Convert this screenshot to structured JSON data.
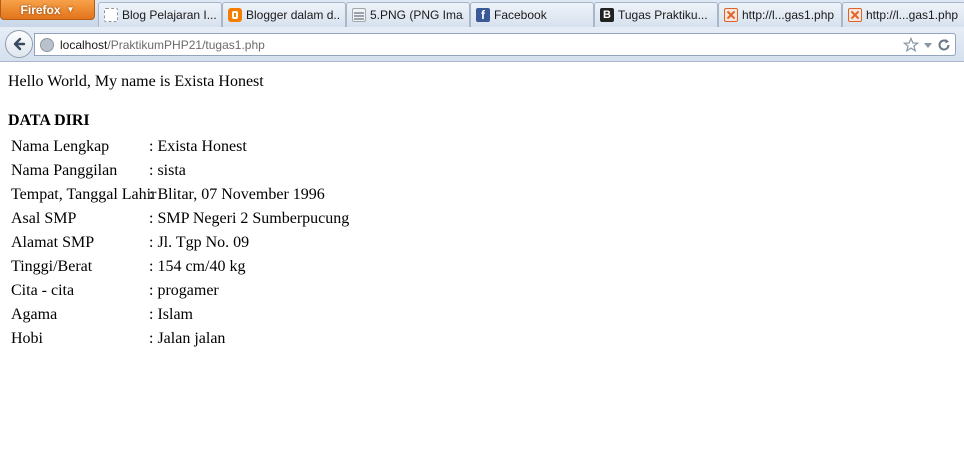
{
  "browser": {
    "menu_label": "Firefox",
    "tabs": [
      {
        "label": "Blog Pelajaran I...",
        "icon": "blank-page-icon"
      },
      {
        "label": "Blogger dalam d...",
        "icon": "blogger-icon"
      },
      {
        "label": "5.PNG (PNG Ima...",
        "icon": "image-file-icon"
      },
      {
        "label": "Facebook",
        "icon": "facebook-icon"
      },
      {
        "label": "Tugas Praktiku...",
        "icon": "blogger-b-icon"
      },
      {
        "label": "http://l...gas1.php",
        "icon": "xampp-icon"
      },
      {
        "label": "http://l...gas1.php",
        "icon": "xampp-icon"
      }
    ],
    "url": {
      "host": "localhost",
      "path": "/PraktikumPHP21/tugas1.php"
    }
  },
  "page": {
    "greeting": "Hello World, My name is Exista Honest",
    "section_title": "DATA DIRI",
    "rows": [
      {
        "label": "Nama Lengkap",
        "value": ": Exista Honest"
      },
      {
        "label": "Nama Panggilan",
        "value": ": sista"
      },
      {
        "label": "Tempat, Tanggal Lahir",
        "value": ": Blitar, 07 November 1996"
      },
      {
        "label": "Asal SMP",
        "value": ": SMP Negeri 2 Sumberpucung"
      },
      {
        "label": "Alamat SMP",
        "value": ": Jl. Tgp No. 09"
      },
      {
        "label": "Tinggi/Berat",
        "value": ": 154 cm/40 kg"
      },
      {
        "label": "Cita - cita",
        "value": ": progamer"
      },
      {
        "label": "Agama",
        "value": ": Islam"
      },
      {
        "label": "Hobi",
        "value": ": Jalan jalan"
      }
    ]
  }
}
